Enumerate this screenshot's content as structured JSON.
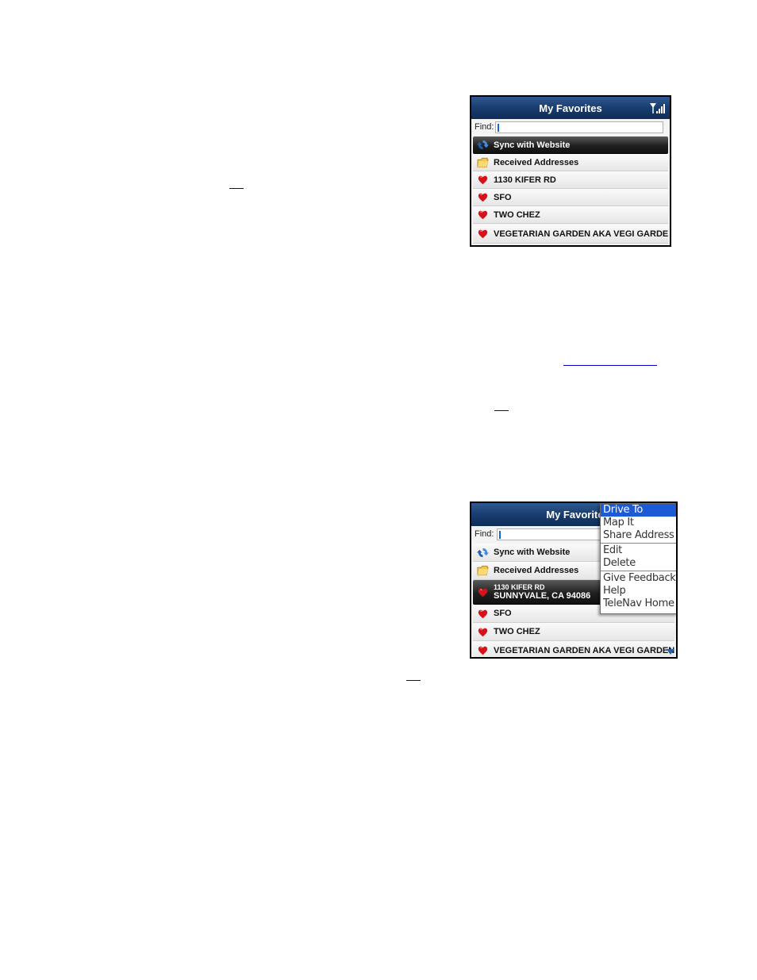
{
  "document": {
    "footnote_links": [
      {
        "text": "",
        "id": "ref-1"
      },
      {
        "text": "",
        "id": "ref-2"
      },
      {
        "text": "",
        "id": "ref-3"
      },
      {
        "text": "",
        "id": "ref-4"
      }
    ]
  },
  "screen1": {
    "title": "My Favorites",
    "find_label": "Find:",
    "find_value": "",
    "items": [
      {
        "label": "Sync with Website",
        "icon": "sync-icon",
        "selected": true
      },
      {
        "label": "Received Addresses",
        "icon": "folder-icon",
        "selected": false
      },
      {
        "label": "1130 KIFER RD",
        "icon": "favorite-heart-icon",
        "selected": false
      },
      {
        "label": "SFO",
        "icon": "favorite-heart-icon",
        "selected": false
      },
      {
        "label": "TWO CHEZ",
        "icon": "favorite-heart-icon",
        "selected": false
      },
      {
        "label": "VEGETARIAN GARDEN AKA VEGI GARDEN",
        "icon": "favorite-heart-icon",
        "selected": false
      }
    ]
  },
  "screen2": {
    "title": "My Favorites",
    "find_label": "Find:",
    "find_value": "",
    "items": [
      {
        "label": "Sync with Website",
        "icon": "sync-icon"
      },
      {
        "label": "Received Addresses",
        "icon": "folder-icon"
      },
      {
        "label": "1130 KIFER RD",
        "sublabel": "SUNNYVALE, CA 94086",
        "icon": "favorite-heart-icon",
        "selected": true
      },
      {
        "label": "SFO",
        "icon": "favorite-heart-icon"
      },
      {
        "label": "TWO CHEZ",
        "icon": "favorite-heart-icon"
      },
      {
        "label": "VEGETARIAN GARDEN AKA VEGI GARDEN",
        "icon": "favorite-heart-icon"
      }
    ],
    "menu": {
      "items": [
        "Drive To",
        "Map It",
        "Share Address",
        "Edit",
        "Delete",
        "Give Feedback",
        "Help",
        "TeleNav Home"
      ],
      "active": "Drive To"
    }
  },
  "colors": {
    "titlebar": "#1a3f72",
    "selected_row": "#202020",
    "menu_highlight": "#1d5bd6",
    "heart": "#d8121b",
    "link": "#0000cc"
  }
}
